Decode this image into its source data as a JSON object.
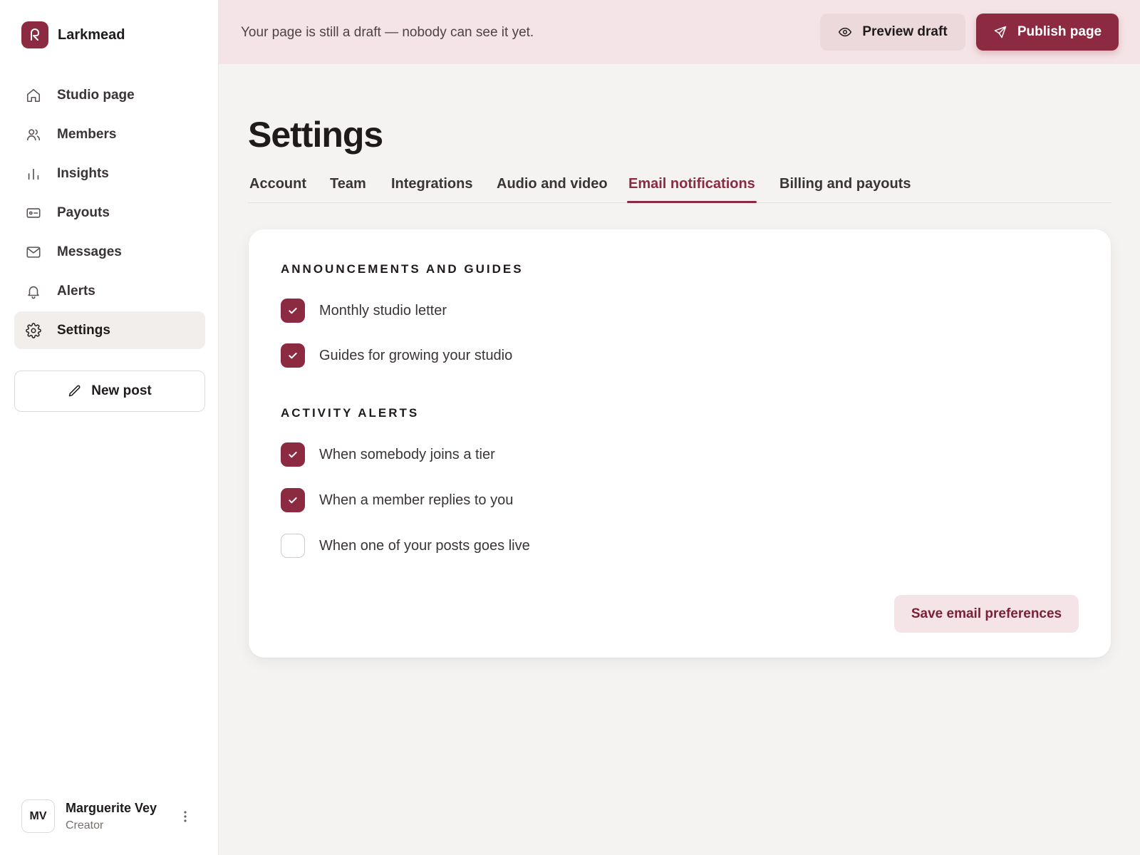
{
  "brand": {
    "name": "Larkmead"
  },
  "sidebar": {
    "items": [
      {
        "label": "Studio page",
        "icon": "home-icon"
      },
      {
        "label": "Members",
        "icon": "members-icon"
      },
      {
        "label": "Insights",
        "icon": "bar-chart-icon"
      },
      {
        "label": "Payouts",
        "icon": "payouts-icon"
      },
      {
        "label": "Messages",
        "icon": "mail-icon"
      },
      {
        "label": "Alerts",
        "icon": "bell-icon"
      },
      {
        "label": "Settings",
        "icon": "gear-icon",
        "active": true
      }
    ],
    "new_post_label": "New post"
  },
  "user": {
    "initials": "MV",
    "name": "Marguerite Vey",
    "role": "Creator"
  },
  "banner": {
    "text": "Your page is still a draft — nobody can see it yet.",
    "preview_label": "Preview draft",
    "publish_label": "Publish page"
  },
  "page": {
    "title": "Settings"
  },
  "tabs": [
    {
      "label": "Account"
    },
    {
      "label": "Team"
    },
    {
      "label": "Integrations"
    },
    {
      "label": "Audio and video"
    },
    {
      "label": "Email notifications",
      "active": true
    },
    {
      "label": "Billing and payouts"
    }
  ],
  "email": {
    "sections": [
      {
        "title": "ANNOUNCEMENTS AND GUIDES",
        "options": [
          {
            "label": "Monthly studio letter",
            "checked": true
          },
          {
            "label": "Guides for growing your studio",
            "checked": true
          }
        ]
      },
      {
        "title": "ACTIVITY ALERTS",
        "options": [
          {
            "label": "When somebody joins a tier",
            "checked": true
          },
          {
            "label": "When a member replies to you",
            "checked": true
          },
          {
            "label": "When one of your posts goes live",
            "checked": false
          }
        ]
      }
    ],
    "save_label": "Save email preferences"
  },
  "colors": {
    "accent": "#8c2a42",
    "banner_bg": "#f5e4e7",
    "page_bg": "#f4f3f1"
  }
}
